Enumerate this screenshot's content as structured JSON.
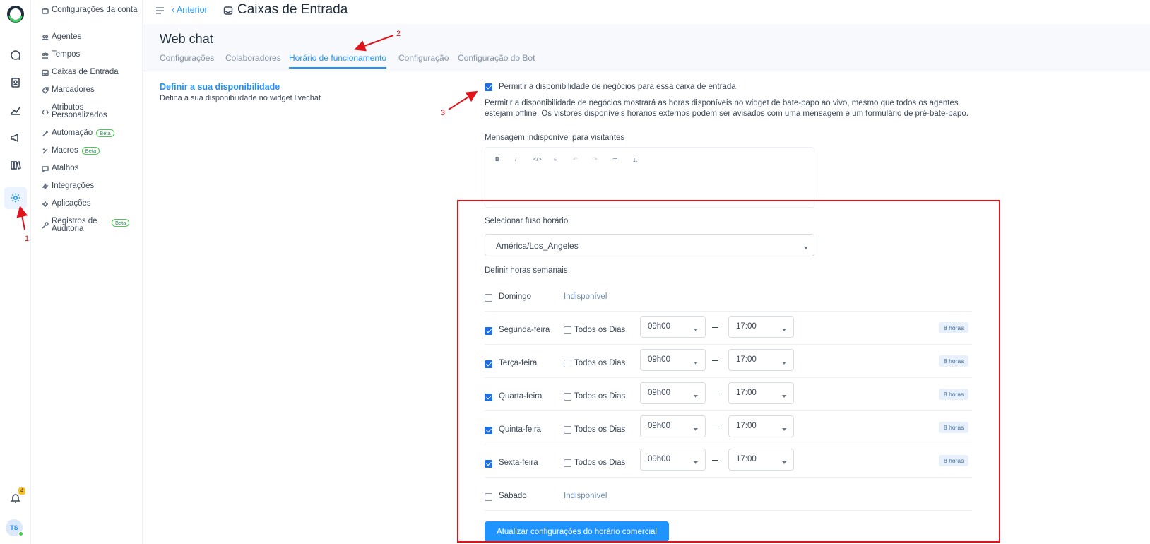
{
  "header": {
    "back_label": "Anterior",
    "title": "Caixas de Entrada"
  },
  "sidebar": {
    "items": [
      {
        "label": "Configurações da conta",
        "icon": "briefcase-icon"
      },
      {
        "label": "Agentes",
        "icon": "people-icon"
      },
      {
        "label": "Tempos",
        "icon": "team-icon"
      },
      {
        "label": "Caixas de Entrada",
        "icon": "inbox-icon"
      },
      {
        "label": "Marcadores",
        "icon": "tag-icon"
      },
      {
        "label": "Atributos Personalizados",
        "icon": "code-icon"
      },
      {
        "label": "Automação",
        "icon": "automation-icon",
        "badge": "Beta"
      },
      {
        "label": "Macros",
        "icon": "macro-icon",
        "badge": "Beta"
      },
      {
        "label": "Atalhos",
        "icon": "chat-shortcut-icon"
      },
      {
        "label": "Integrações",
        "icon": "flash-icon"
      },
      {
        "label": "Aplicações",
        "icon": "apps-icon"
      },
      {
        "label": "Registros de Auditoria",
        "icon": "key-icon",
        "badge": "Beta"
      }
    ]
  },
  "rail": {
    "items": [
      "conversations-icon",
      "contacts-icon",
      "reports-icon",
      "campaigns-icon",
      "library-icon",
      "settings-icon"
    ],
    "notifications_count": "4",
    "avatar_initials": "TS"
  },
  "inbox": {
    "name": "Web chat",
    "tabs": [
      "Configurações",
      "Colaboradores",
      "Horário de funcionamento",
      "Configuração",
      "Configuração do Bot"
    ],
    "active_tab": "Horário de funcionamento"
  },
  "business_hours": {
    "section_title": "Definir a sua disponibilidade",
    "section_description": "Defina a sua disponibilidade no widget livechat",
    "enable_label": "Permitir a disponibilidade de negócios para essa caixa de entrada",
    "enabled": true,
    "enable_help": "Permitir a disponibilidade de negócios mostrará as horas disponíveis no widget de bate-papo ao vivo, mesmo que todos os agentes estejam offline. Os vistores disponíveis horários externos podem ser avisados com uma mensagem e um formulário de pré-bate-papo.",
    "unavailable_message_label": "Mensagem indisponível para visitantes",
    "editor_toolbar": [
      "bold-icon",
      "italic-icon",
      "code-icon",
      "link-icon",
      "undo-icon",
      "redo-icon",
      "bullet-list-icon",
      "numbered-list-icon"
    ],
    "toolbar_glyphs": [
      "B",
      "I",
      "</>",
      "⊖",
      "↶",
      "↷",
      "≔",
      "⒈"
    ],
    "timezone_label": "Selecionar fuso horário",
    "timezone_value": "América/Los_Angeles",
    "weekly_label": "Definir horas semanais",
    "all_day_label": "Todos os Dias",
    "unavailable_text": "Indisponível",
    "days": [
      {
        "name": "Domingo",
        "enabled": false
      },
      {
        "name": "Segunda-feira",
        "enabled": true,
        "from": "09h00",
        "to": "17:00",
        "duration": "8 horas"
      },
      {
        "name": "Terça-feira",
        "enabled": true,
        "from": "09h00",
        "to": "17:00",
        "duration": "8 horas"
      },
      {
        "name": "Quarta-feira",
        "enabled": true,
        "from": "09h00",
        "to": "17:00",
        "duration": "8 horas"
      },
      {
        "name": "Quinta-feira",
        "enabled": true,
        "from": "09h00",
        "to": "17:00",
        "duration": "8 horas"
      },
      {
        "name": "Sexta-feira",
        "enabled": true,
        "from": "09h00",
        "to": "17:00",
        "duration": "8 horas"
      },
      {
        "name": "Sábado",
        "enabled": false
      }
    ],
    "save_label": "Atualizar configurações do horário comercial"
  },
  "annotations": {
    "labels": [
      "1",
      "2",
      "3"
    ],
    "color": "#e0131b"
  },
  "colors": {
    "accent": "#1f93ff",
    "checkbox": "#1f6fde",
    "annotation": "#e0131b"
  }
}
